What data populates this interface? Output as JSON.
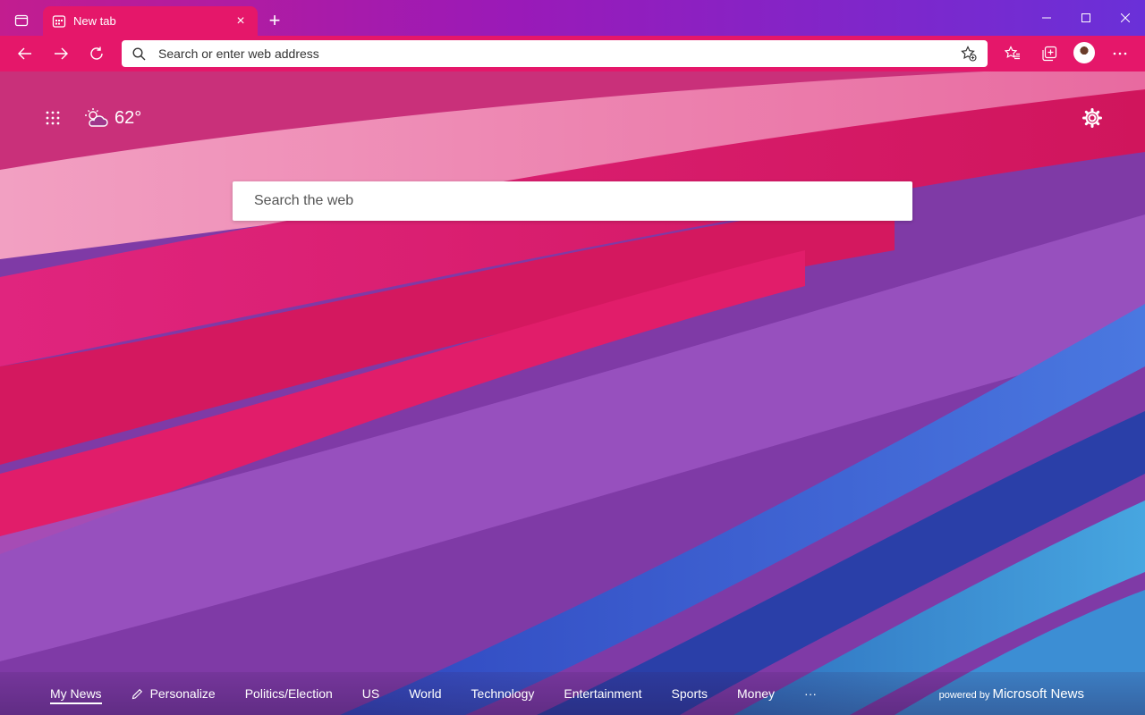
{
  "tab": {
    "title": "New tab"
  },
  "address_bar": {
    "placeholder": "Search or enter web address"
  },
  "weather": {
    "temperature": "62°"
  },
  "search": {
    "placeholder": "Search the web"
  },
  "news_nav": {
    "items": [
      {
        "label": "My News",
        "active": true
      },
      {
        "label": "Personalize"
      },
      {
        "label": "Politics/Election"
      },
      {
        "label": "US"
      },
      {
        "label": "World"
      },
      {
        "label": "Technology"
      },
      {
        "label": "Entertainment"
      },
      {
        "label": "Sports"
      },
      {
        "label": "Money"
      }
    ],
    "more_label": "···"
  },
  "powered_by": {
    "prefix": "powered by",
    "brand": "Microsoft News"
  },
  "colors": {
    "accent": "#e5176a",
    "titlebar_start": "#c21d8f",
    "titlebar_end": "#6a30d8"
  }
}
